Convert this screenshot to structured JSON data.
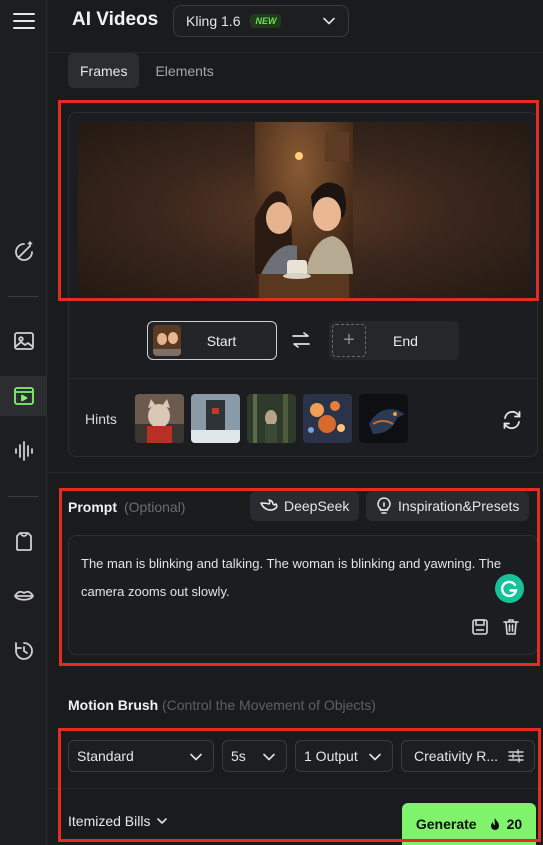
{
  "app": {
    "title": "AI Videos",
    "model": {
      "name": "Kling 1.6",
      "badge": "NEW"
    }
  },
  "sidebar": {
    "items": [
      {
        "name": "menu-icon"
      },
      {
        "name": "magic-wand-icon"
      },
      {
        "name": "image-icon"
      },
      {
        "name": "video-icon",
        "active": true
      },
      {
        "name": "audio-wave-icon"
      },
      {
        "name": "shirt-icon"
      },
      {
        "name": "lips-icon"
      },
      {
        "name": "history-icon"
      }
    ]
  },
  "tabs": [
    {
      "label": "Frames",
      "active": true
    },
    {
      "label": "Elements",
      "active": false
    }
  ],
  "frames": {
    "start_label": "Start",
    "end_label": "End",
    "end_plus": "+",
    "hints_label": "Hints"
  },
  "prompt": {
    "label": "Prompt",
    "optional": "(Optional)",
    "deepseek_label": "DeepSeek",
    "inspiration_label": "Inspiration&Presets",
    "text": "The man is blinking and talking. The woman is blinking and yawning. The camera zooms out slowly."
  },
  "motion_brush": {
    "label": "Motion Brush",
    "sub": "(Control the Movement of Objects)"
  },
  "settings": {
    "mode": "Standard",
    "duration": "5s",
    "outputs": "1 Output",
    "creativity": "Creativity R..."
  },
  "footer": {
    "bills_label": "Itemized Bills",
    "generate_label": "Generate",
    "credits": "20"
  },
  "colors": {
    "accent": "#7ff36b",
    "highlight": "#e62b22",
    "background": "#1a1b1d"
  }
}
